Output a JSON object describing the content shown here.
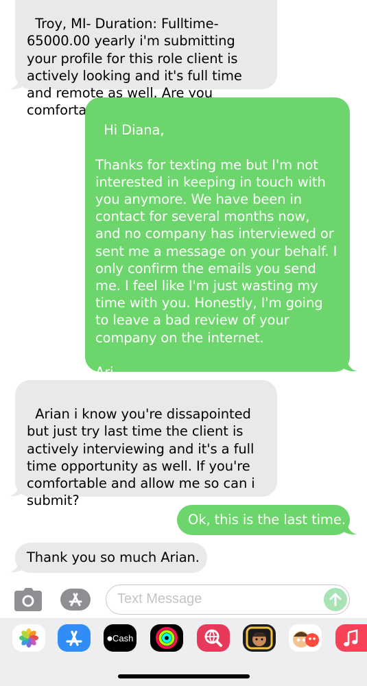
{
  "messages": [
    {
      "direction": "incoming",
      "text": "Troy, MI- Duration: Fulltime- 65000.00 yearly i'm submitting your profile for this role client is actively looking and it's full time and remote as well. Are you comfortable?"
    },
    {
      "direction": "outgoing",
      "text": "Hi Diana,\n\nThanks for texting me but I'm not interested in keeping in touch with you anymore. We have been in contact for several months now, and no company has interviewed or sent me a message on your behalf. I only confirm the emails you send me. I feel like I'm just wasting my time with you. Honestly, I'm going to leave a bad review of your company on the internet.\n\nAri"
    },
    {
      "direction": "incoming",
      "text": "Arian i know you're dissapointed but just try last time the client is actively interviewing and it's a full time opportunity as well. If you're comfortable and allow me so can i submit?"
    },
    {
      "direction": "outgoing",
      "text": "Ok, this is the last time."
    },
    {
      "direction": "incoming",
      "text": "Thank you so much Arian."
    }
  ],
  "compose": {
    "placeholder": "Text Message",
    "camera_icon": "camera-icon",
    "apps_icon": "app-store-icon",
    "send_icon": "arrow-up-icon"
  },
  "app_tray": [
    {
      "name": "photos-app-icon"
    },
    {
      "name": "app-store-app-icon"
    },
    {
      "name": "apple-cash-app-icon",
      "label": "Cash"
    },
    {
      "name": "activity-app-icon"
    },
    {
      "name": "web-search-app-icon"
    },
    {
      "name": "memoji-app-icon"
    },
    {
      "name": "memoji-stickers-app-icon"
    },
    {
      "name": "music-app-icon"
    }
  ],
  "colors": {
    "outgoing_bubble": "#6cd66c",
    "incoming_bubble": "#e9e9eb",
    "send_button": "#a8e3b6"
  }
}
